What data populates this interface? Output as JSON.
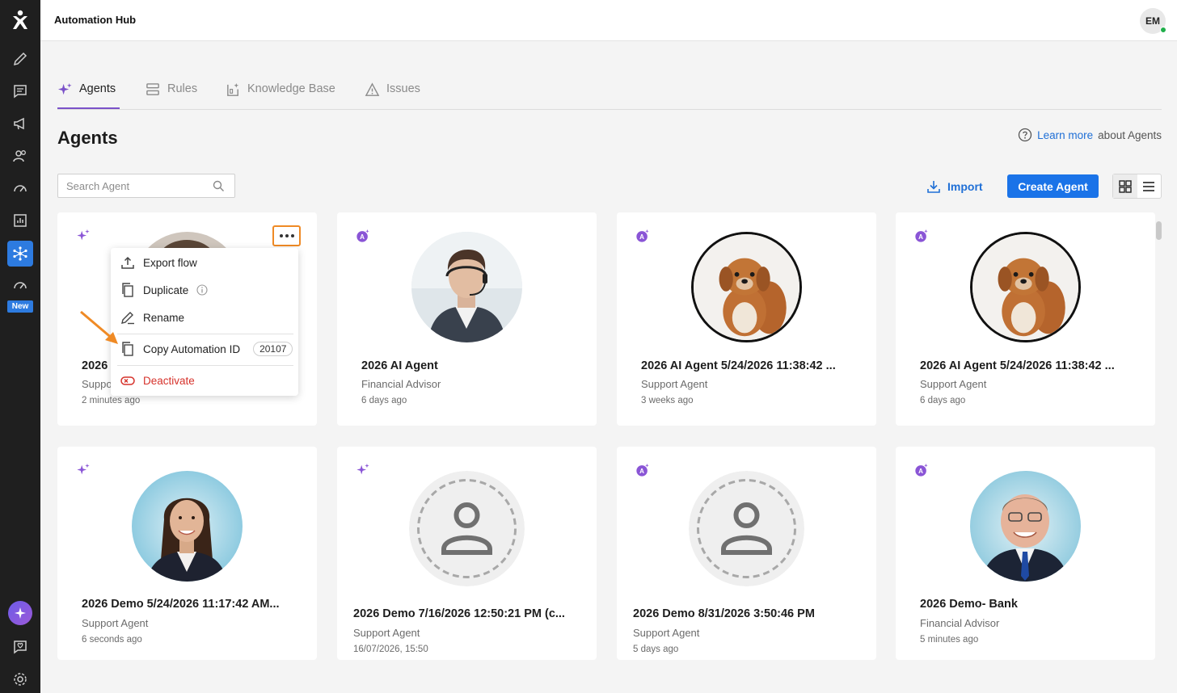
{
  "app": {
    "title": "Automation Hub",
    "user_initials": "EM"
  },
  "sidebar": {
    "new_badge": "New"
  },
  "tabs": [
    {
      "label": "Agents",
      "icon": "sparkle-icon",
      "active": true
    },
    {
      "label": "Rules",
      "icon": "rules-icon",
      "active": false
    },
    {
      "label": "Knowledge Base",
      "icon": "knowledge-base-icon",
      "active": false
    },
    {
      "label": "Issues",
      "icon": "warning-icon",
      "active": false
    }
  ],
  "page": {
    "heading": "Agents",
    "learn_more_link": "Learn more",
    "learn_more_suffix": "about Agents"
  },
  "toolbar": {
    "search_placeholder": "Search Agent",
    "import_label": "Import",
    "create_label": "Create Agent"
  },
  "cards": [
    {
      "name": "2026",
      "role": "Support",
      "time": "2 minutes ago",
      "badge": "sparkle"
    },
    {
      "name": "2026 AI Agent",
      "role": "Financial Advisor",
      "time": "6 days ago",
      "badge": "ai"
    },
    {
      "name": "2026 AI Agent 5/24/2026 11:38:42 ...",
      "role": "Support Agent",
      "time": "3 weeks ago",
      "badge": "ai"
    },
    {
      "name": "2026 AI Agent 5/24/2026 11:38:42 ...",
      "role": "Support Agent",
      "time": "6 days ago",
      "badge": "ai"
    },
    {
      "name": "2026 Demo 5/24/2026 11:17:42 AM...",
      "role": "Support Agent",
      "time": "6 seconds ago",
      "badge": "sparkle"
    },
    {
      "name": "2026 Demo 7/16/2026 12:50:21 PM (c...",
      "role": "Support Agent",
      "time": "16/07/2026, 15:50",
      "badge": "sparkle"
    },
    {
      "name": "2026 Demo 8/31/2026 3:50:46 PM",
      "role": "Support Agent",
      "time": "5 days ago",
      "badge": "ai"
    },
    {
      "name": "2026 Demo- Bank",
      "role": "Financial Advisor",
      "time": "5 minutes ago",
      "badge": "ai"
    }
  ],
  "context_menu": {
    "export": "Export flow",
    "duplicate": "Duplicate",
    "rename": "Rename",
    "copy_id": "Copy Automation ID",
    "automation_id": "20107",
    "deactivate": "Deactivate"
  },
  "colors": {
    "accent": "#1a73e8",
    "purple": "#7b52c9",
    "highlight": "#ef8a25",
    "danger": "#d6322b"
  }
}
